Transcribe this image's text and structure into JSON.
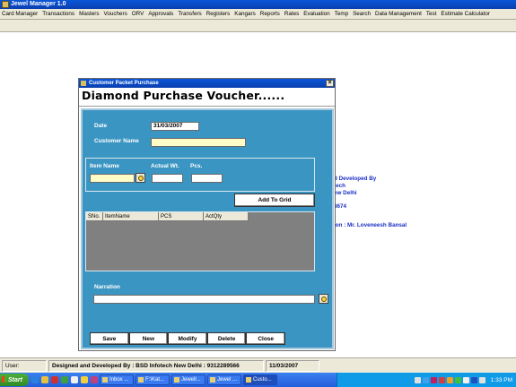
{
  "app": {
    "title": "Jewel Manager 1.0"
  },
  "menu": [
    "Card Manager",
    "Transactions",
    "Masters",
    "Vouchers",
    "ORV",
    "Approvals",
    "Transfers",
    "Registers",
    "Kangars",
    "Reports",
    "Rates",
    "Evaluation",
    "Temp",
    "Search",
    "Data Management",
    "Test",
    "Estimate Calculator"
  ],
  "background": {
    "line1": "d Developed By",
    "line2": "tech",
    "line3": "ew Delhi",
    "line4": "8674",
    "line5": "ion : Mr. Loveneesh Bansal"
  },
  "dialog": {
    "title": "Customer Packet Purchase",
    "close_symbol": "×",
    "header": "Diamond Purchase Voucher......",
    "date_label": "Date",
    "date_value": "31/03/2007",
    "customer_label": "Customer Name",
    "customer_value": "",
    "item_name_label": "Item Name",
    "item_name_value": "",
    "actual_wt_label": "Actual Wt.",
    "actual_wt_value": "",
    "pcs_label": "Pcs.",
    "pcs_value": "",
    "add_to_grid": "Add To Grid",
    "grid_columns": [
      "SNo.",
      "ItemName",
      "PCS",
      "ActQty"
    ],
    "narration_label": "Narration",
    "narration_value": "",
    "buttons": {
      "save": "Save",
      "new": "New",
      "modify": "Modify",
      "delete": "Delete",
      "close": "Close"
    }
  },
  "statusbar": {
    "user": "User:",
    "designed": "Designed and Developed By : BSD Infotech New Delhi : 9312289566",
    "date": "11/03/2007"
  },
  "taskbar": {
    "start": "Start",
    "tasks": [
      "Inbox ...",
      "F:\\Kat...",
      "Jewell...",
      "Jewel ...",
      "Custo..."
    ],
    "clock": "1:33 PM"
  },
  "colors": {
    "titlebar": "#0a55d8",
    "panel": "#3b95c2",
    "field_highlight": "#fffcc8",
    "bg_text": "#1a2fc4"
  },
  "icons": {
    "lookup": "magnifier-icon",
    "start": "windows-flag-icon"
  }
}
